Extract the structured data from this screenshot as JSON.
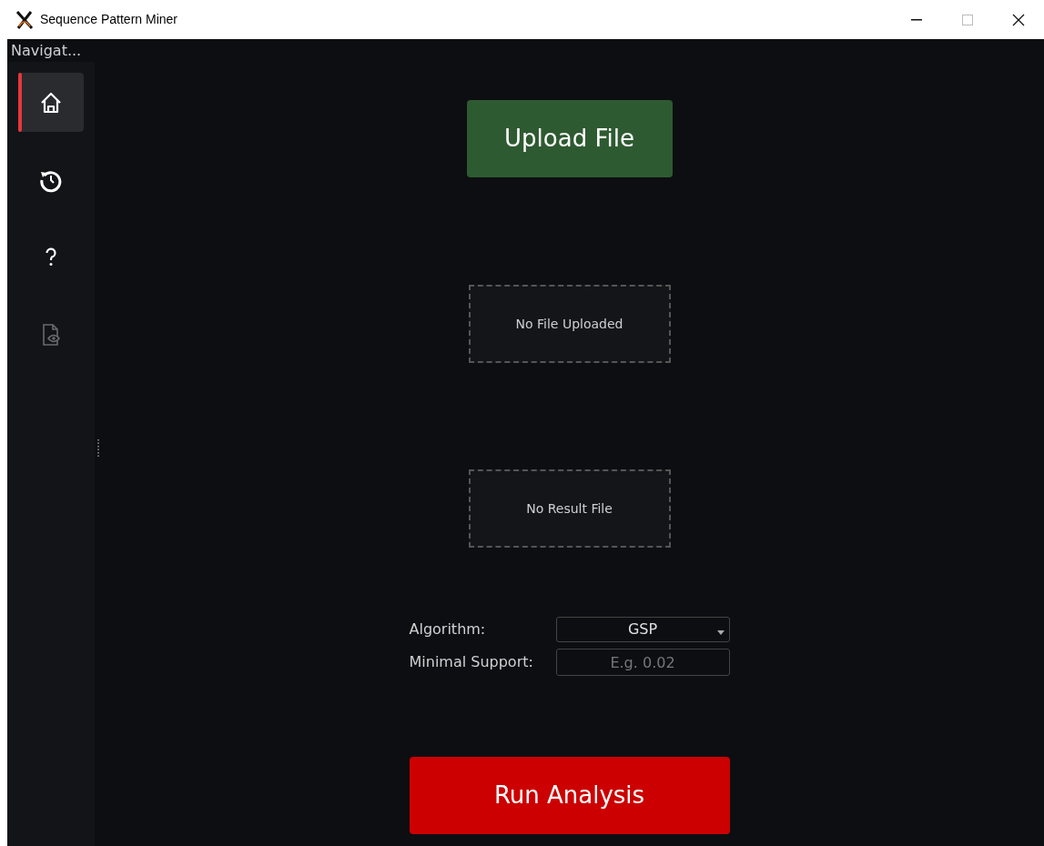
{
  "window": {
    "title": "Sequence Pattern Miner"
  },
  "sidebar": {
    "title": "Navigat...",
    "items": [
      {
        "selected": true,
        "disabled": false
      },
      {
        "selected": false,
        "disabled": false
      },
      {
        "selected": false,
        "disabled": false
      },
      {
        "selected": false,
        "disabled": true
      }
    ]
  },
  "upload_button": "Upload File",
  "uploaded_file": "No File Uploaded",
  "result_file": "No Result File",
  "form": {
    "algorithm_label": "Algorithm:",
    "algorithm_value": "GSP",
    "support_label": "Minimal Support:",
    "support_placeholder": "E.g. 0.02"
  },
  "run_button": "Run Analysis"
}
